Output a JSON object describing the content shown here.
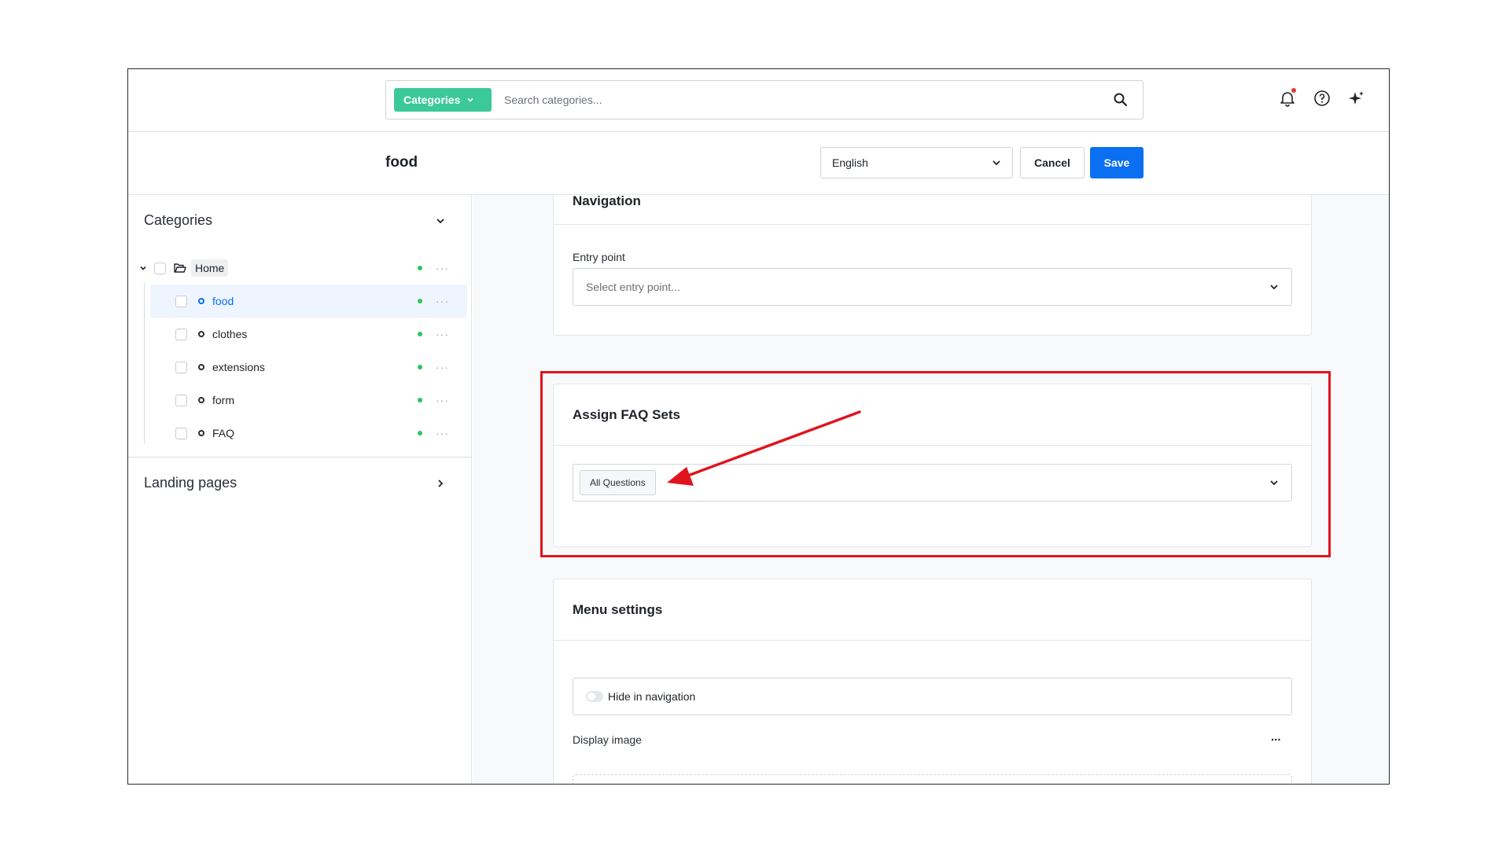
{
  "topbar": {
    "category_button": "Categories",
    "search_placeholder": "Search categories..."
  },
  "header": {
    "title": "food",
    "language": "English",
    "cancel_label": "Cancel",
    "save_label": "Save"
  },
  "sidebar": {
    "categories_heading": "Categories",
    "root": "Home",
    "items": [
      {
        "label": "food",
        "selected": true
      },
      {
        "label": "clothes",
        "selected": false
      },
      {
        "label": "extensions",
        "selected": false
      },
      {
        "label": "form",
        "selected": false
      },
      {
        "label": "FAQ",
        "selected": false
      }
    ],
    "landing_pages": "Landing pages"
  },
  "navigation_card": {
    "title": "Navigation",
    "entry_label": "Entry point",
    "entry_placeholder": "Select entry point..."
  },
  "faq_card": {
    "title": "Assign FAQ Sets",
    "selected_tag": "All Questions"
  },
  "menu_card": {
    "title": "Menu settings",
    "hide_toggle_label": "Hide in navigation",
    "display_image_label": "Display image",
    "more": "..."
  },
  "colors": {
    "accent": "#0b6ff2",
    "category_pill": "#3cc99a",
    "status_green": "#2ec55e",
    "annotation_red": "#e0141e"
  }
}
